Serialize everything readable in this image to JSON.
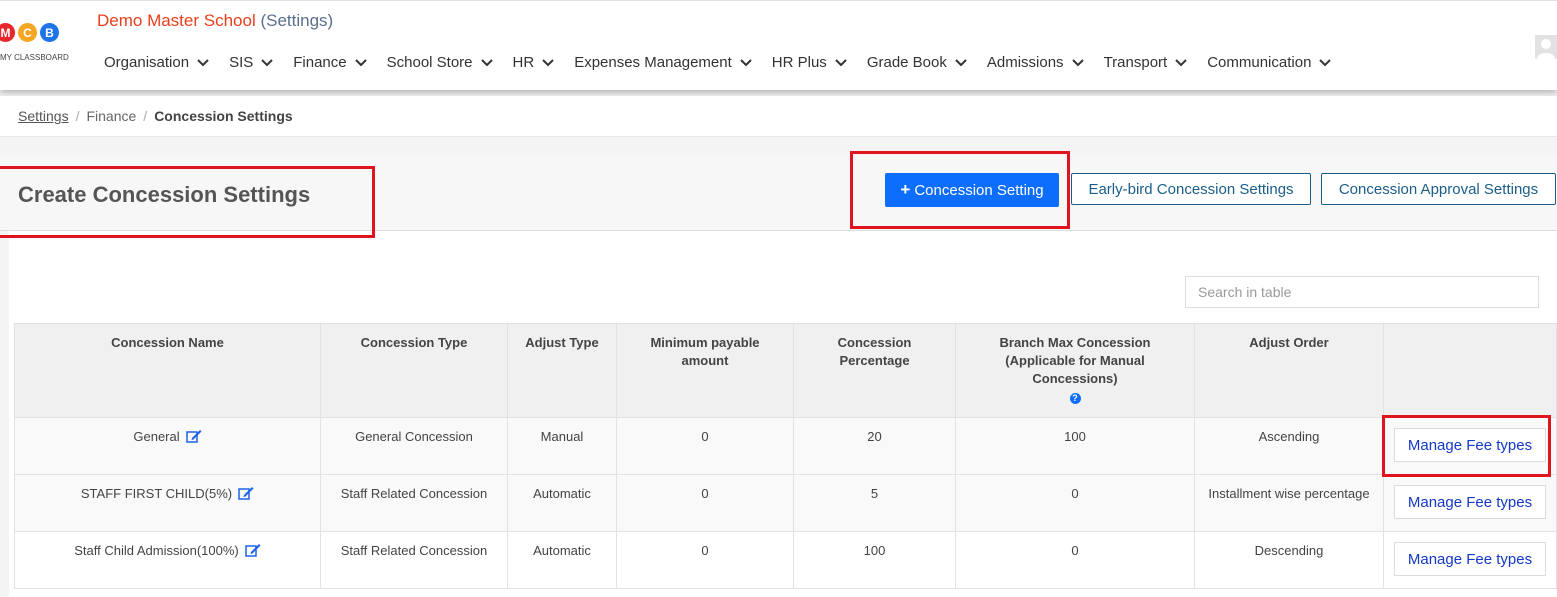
{
  "header": {
    "logo_letters": [
      "M",
      "C",
      "B"
    ],
    "logo_colors": [
      "#e8262b",
      "#f5a623",
      "#1e73e8"
    ],
    "logo_subtitle": "MY CLASSBOARD",
    "school_name": "Demo Master School",
    "school_subtitle": "(Settings)",
    "nav": [
      {
        "label": "Organisation"
      },
      {
        "label": "SIS"
      },
      {
        "label": "Finance"
      },
      {
        "label": "School Store"
      },
      {
        "label": "HR"
      },
      {
        "label": "Expenses Management"
      },
      {
        "label": "HR Plus"
      },
      {
        "label": "Grade Book"
      },
      {
        "label": "Admissions"
      },
      {
        "label": "Transport"
      },
      {
        "label": "Communication"
      }
    ]
  },
  "breadcrumb": {
    "root": "Settings",
    "middle": "Finance",
    "current": "Concession Settings",
    "separator": "/"
  },
  "page": {
    "title": "Create Concession Settings",
    "add_button_icon": "+",
    "add_button": "Concession Setting",
    "earlybird_button": "Early-bird Concession Settings",
    "approval_button": "Concession Approval Settings"
  },
  "search": {
    "placeholder": "Search in table"
  },
  "table": {
    "headers": [
      "Concession Name",
      "Concession Type",
      "Adjust Type",
      "Minimum payable amount",
      "Concession Percentage",
      "Branch Max Concession (Applicable for Manual Concessions)",
      "Adjust Order",
      ""
    ],
    "help_icon": "?",
    "rows": [
      {
        "name": "General",
        "type": "General Concession",
        "adjust_type": "Manual",
        "min_payable": "0",
        "percentage": "20",
        "branch_max": "100",
        "adjust_order": "Ascending",
        "action": "Manage Fee types"
      },
      {
        "name": "STAFF FIRST CHILD(5%)",
        "type": "Staff Related Concession",
        "adjust_type": "Automatic",
        "min_payable": "0",
        "percentage": "5",
        "branch_max": "0",
        "adjust_order": "Installment wise percentage",
        "action": "Manage Fee types"
      },
      {
        "name": "Staff Child Admission(100%)",
        "type": "Staff Related Concession",
        "adjust_type": "Automatic",
        "min_payable": "0",
        "percentage": "100",
        "branch_max": "0",
        "adjust_order": "Descending",
        "action": "Manage Fee types"
      }
    ]
  },
  "colors": {
    "brand_orange": "#e8401c",
    "primary_blue": "#0d6efd",
    "highlight_red": "#e0141e",
    "link_blue": "#1438c8"
  }
}
